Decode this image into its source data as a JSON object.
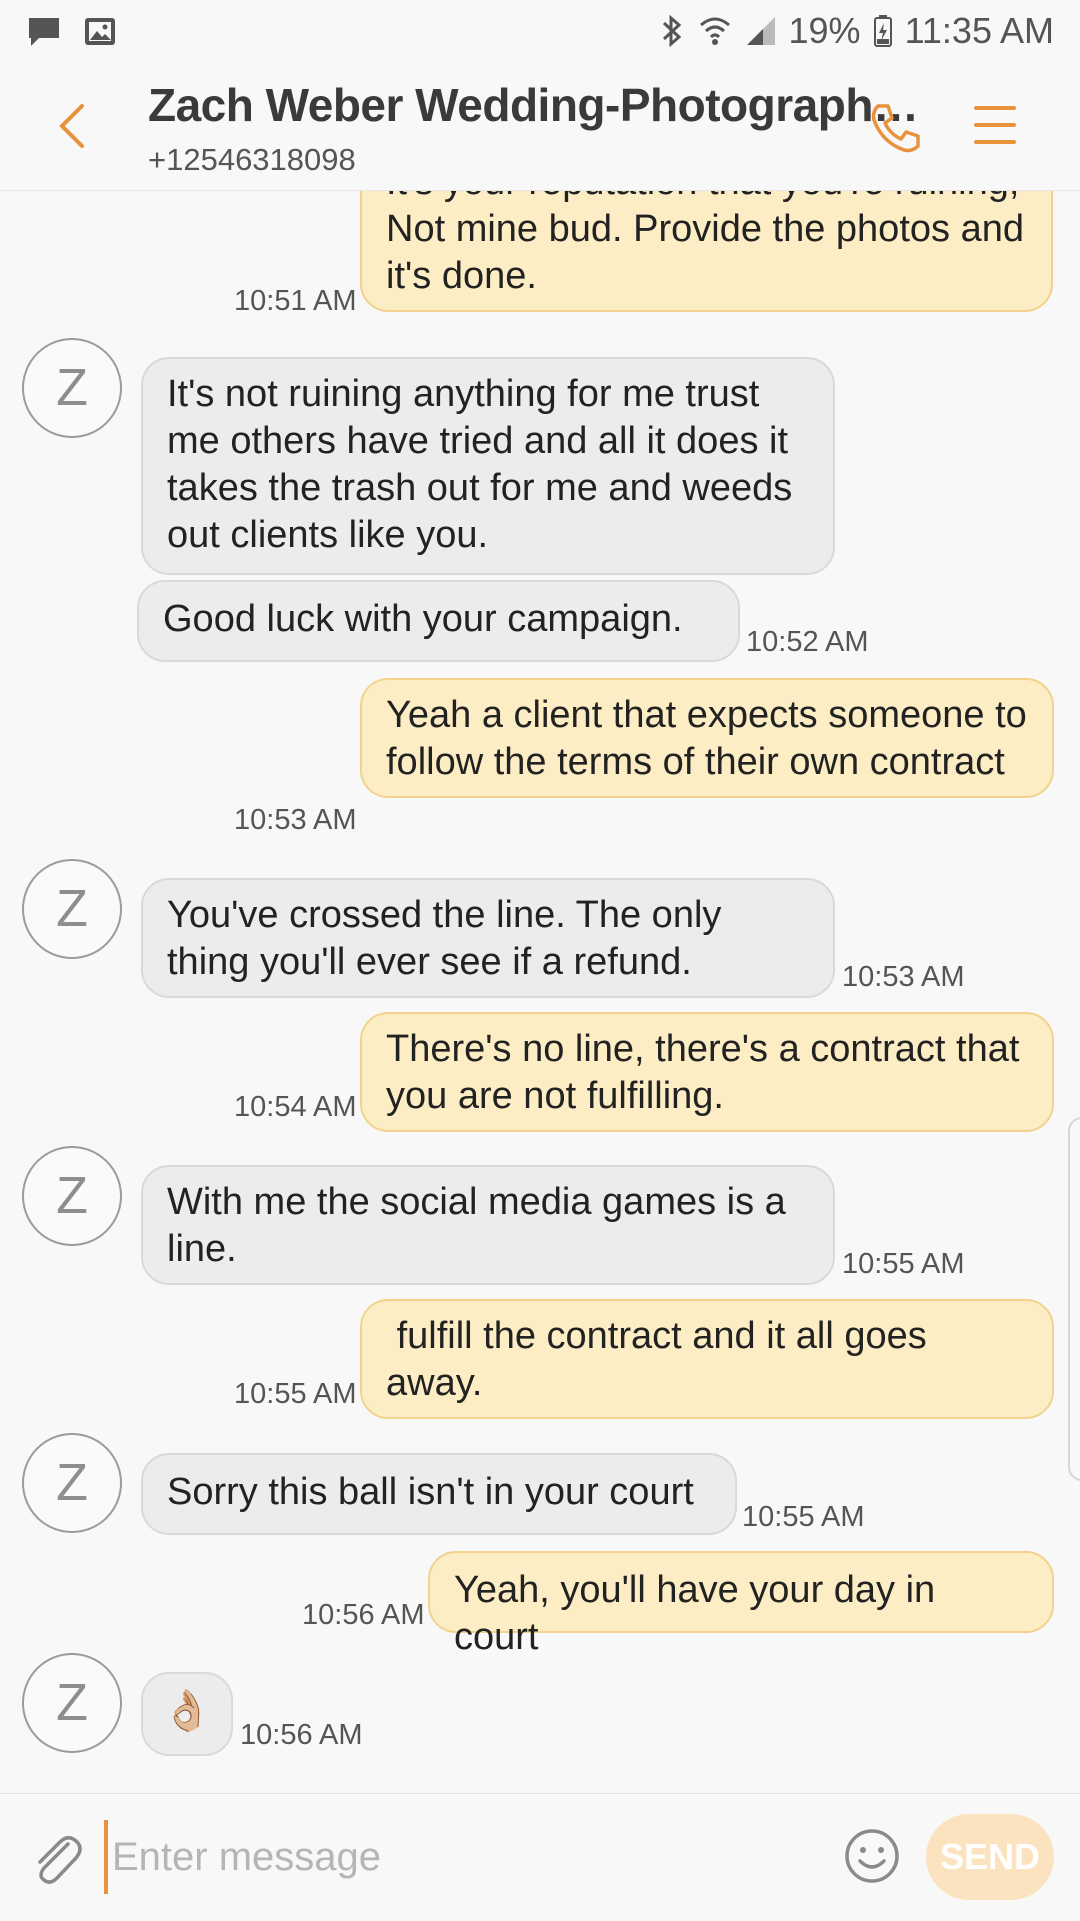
{
  "status_bar": {
    "battery": "19%",
    "time": "11:35 AM",
    "icons": [
      "message-icon",
      "image-icon",
      "bluetooth-icon",
      "wifi-icon",
      "signal-icon",
      "battery-charging-icon"
    ]
  },
  "header": {
    "title": "Zach Weber Wedding-Photograph…",
    "phone": "+12546318098",
    "icons": [
      "back-icon",
      "phone-icon",
      "menu-icon"
    ]
  },
  "colors": {
    "accent": "#e8923c",
    "sent_bubble": "#fdedc4",
    "received_bubble": "#ececec"
  },
  "contact_initial": "Z",
  "messages": [
    {
      "direction": "sent",
      "text": "It's your reputation that you're ruining, Not mine bud. Provide the photos and it's done.",
      "time": "10:51 AM"
    },
    {
      "direction": "received",
      "text": "It's not ruining anything for me trust me others have tried and all it does it takes the trash out for me and weeds out clients like you.",
      "time": ""
    },
    {
      "direction": "received",
      "text": "Good luck with your campaign.",
      "time": "10:52 AM"
    },
    {
      "direction": "sent",
      "text": "Yeah a client that expects someone to follow the terms of their own contract",
      "time": "10:53 AM"
    },
    {
      "direction": "received",
      "text": "You've crossed the line.  The only thing you'll ever see if a refund.",
      "time": "10:53 AM"
    },
    {
      "direction": "sent",
      "text": "There's no line, there's a contract that you are not fulfilling.",
      "time": "10:54 AM"
    },
    {
      "direction": "received",
      "text": "With me the social media games is a line.",
      "time": "10:55 AM"
    },
    {
      "direction": "sent",
      "text": " fulfill the contract and it all goes away.",
      "time": "10:55 AM"
    },
    {
      "direction": "received",
      "text": "Sorry this ball isn't in your court",
      "time": "10:55 AM"
    },
    {
      "direction": "sent",
      "text": "Yeah, you'll have your day in court",
      "time": "10:56 AM"
    },
    {
      "direction": "received",
      "text": "👌🏼",
      "emoji_icon": "ok-hand-emoji-icon",
      "time": "10:56 AM"
    }
  ],
  "compose": {
    "placeholder": "Enter message",
    "send_label": "SEND",
    "icons": [
      "attach-icon",
      "emoji-icon"
    ]
  }
}
